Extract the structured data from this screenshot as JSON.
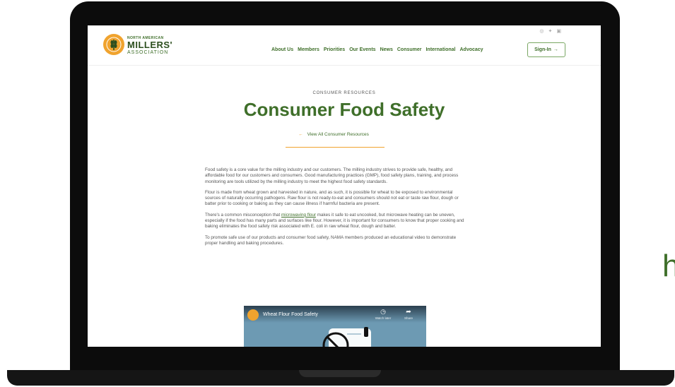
{
  "header": {
    "logo": {
      "top": "NORTH AMERICAN",
      "main": "MILLERS'",
      "sub": "ASSOCIATION"
    },
    "social_icons": [
      "instagram-icon",
      "twitter-icon",
      "linkedin-icon"
    ],
    "nav_items": [
      "About Us",
      "Members",
      "Priorities",
      "Our Events",
      "News",
      "Consumer",
      "International",
      "Advocacy"
    ],
    "signin_label": "Sign-In"
  },
  "main": {
    "eyebrow": "CONSUMER RESOURCES",
    "title": "Consumer Food Safety",
    "back_link": "View All Consumer Resources",
    "paragraphs": {
      "p1": "Food safety is a core value for the milling industry and our customers. The milling industry strives to provide safe, healthy, and affordable food for our customers and consumers. Good manufacturing practices (GMP), food safety plans, training, and process monitoring are tools utilized by the milling industry to meet the highest food safety standards.",
      "p2": "Flour is made from wheat grown and harvested in nature, and as such, it is possible for wheat to be exposed to environmental sources of naturally occurring pathogens. Raw flour is not ready-to-eat and consumers should not eat or taste raw flour, dough or batter prior to cooking or baking as they can cause illness if harmful bacteria are present.",
      "p3_before": "There's a common misconception that ",
      "p3_link": "microwaving flour",
      "p3_after": " makes it safe to eat uncooked, but microwave heating can be uneven, especially if the food has many parts and surfaces like flour. However, it is important for consumers to know that proper cooking and baking eliminates the food safety risk associated with E. coli in raw wheat flour, dough and batter.",
      "p4": "To promote safe use of our products and consumer food safety, NAMA members produced an educational video to demonstrate proper handling and baking procedures."
    },
    "video": {
      "title": "Wheat Flour Food Safety",
      "watch_later": "Watch later",
      "share": "Share"
    }
  },
  "edge_letter": "h",
  "colors": {
    "brand_green": "#3f6f2a",
    "brand_orange": "#f0a32e"
  }
}
